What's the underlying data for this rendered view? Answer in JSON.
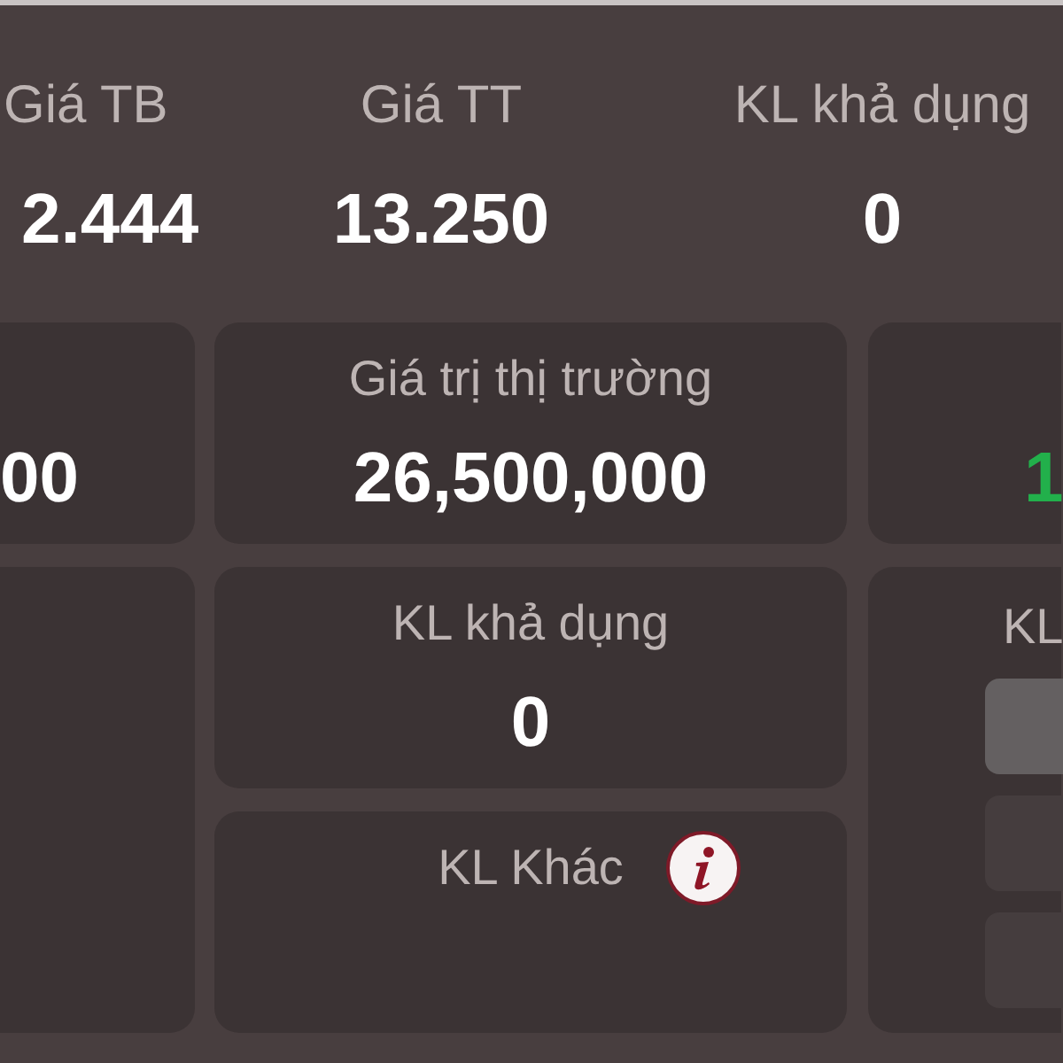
{
  "stats_row": [
    {
      "label": "Giá TB",
      "value": "2.444"
    },
    {
      "label": "Giá TT",
      "value": "13.250"
    },
    {
      "label": "KL khả dụng",
      "value": "0"
    }
  ],
  "panels": [
    {
      "kind": "stat",
      "value": "00",
      "gain": false
    },
    {
      "kind": "stat",
      "label": "Giá trị thị trường",
      "value": "26,500,000",
      "gain": false
    },
    {
      "kind": "stat",
      "value": "1",
      "gain": true
    },
    {
      "kind": "blank"
    },
    {
      "kind": "stack",
      "items": [
        {
          "label": "KL khả dụng",
          "value": "0"
        },
        {
          "label": "KL Khác",
          "info": true
        }
      ]
    },
    {
      "kind": "options",
      "label": "KL",
      "options": [
        {
          "selected": true
        },
        {
          "selected": false
        },
        {
          "selected": false
        }
      ]
    }
  ]
}
